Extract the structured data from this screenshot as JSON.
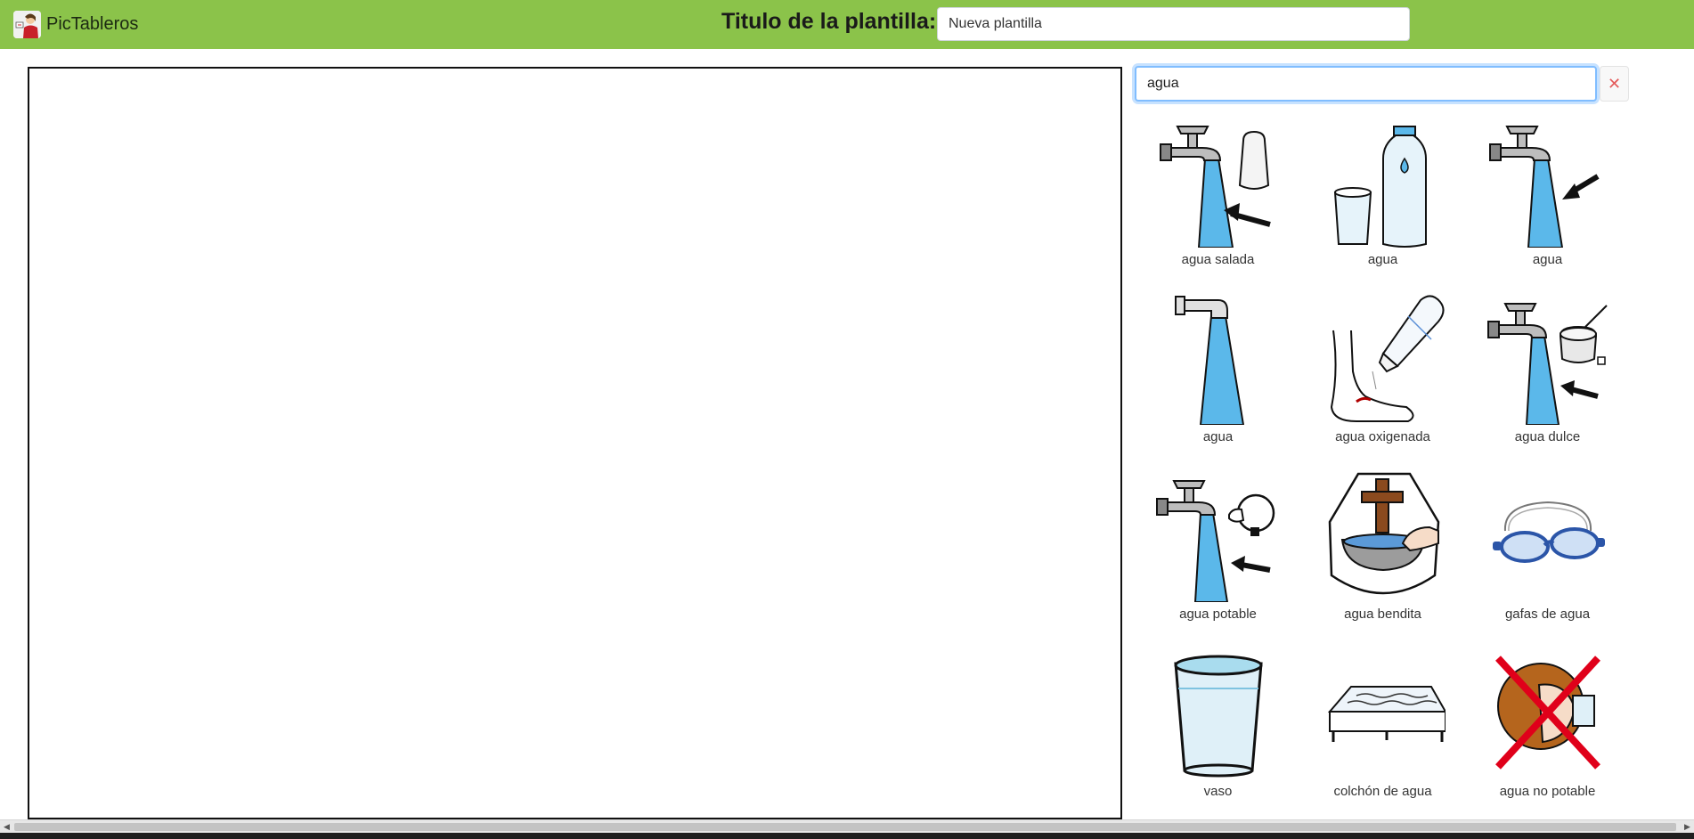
{
  "app": {
    "name": "PicTableros"
  },
  "header": {
    "title_label": "Titulo de la plantilla:",
    "title_value": "Nueva plantilla"
  },
  "search": {
    "query": "agua",
    "clear_symbol": "✕"
  },
  "results": [
    {
      "label": "agua salada",
      "icon": "faucet-with-salt-icon"
    },
    {
      "label": "agua",
      "icon": "water-bottle-and-glass-icon"
    },
    {
      "label": "agua",
      "icon": "faucet-water-arrow-icon"
    },
    {
      "label": "agua",
      "icon": "water-pipe-stream-icon"
    },
    {
      "label": "agua oxigenada",
      "icon": "peroxide-bottle-foot-icon"
    },
    {
      "label": "agua dulce",
      "icon": "faucet-with-sugar-icon"
    },
    {
      "label": "agua potable",
      "icon": "faucet-drinking-person-icon"
    },
    {
      "label": "agua bendita",
      "icon": "holy-water-font-cross-icon"
    },
    {
      "label": "gafas de agua",
      "icon": "swimming-goggles-icon"
    },
    {
      "label": "vaso",
      "icon": "glass-of-water-icon"
    },
    {
      "label": "colchón de agua",
      "icon": "water-mattress-icon"
    },
    {
      "label": "agua no potable",
      "icon": "not-drinkable-crossed-icon"
    }
  ],
  "colors": {
    "header": "#8bc34a",
    "water": "#5bb8ea",
    "focus": "#80bdff",
    "cross": "#e0001a"
  }
}
